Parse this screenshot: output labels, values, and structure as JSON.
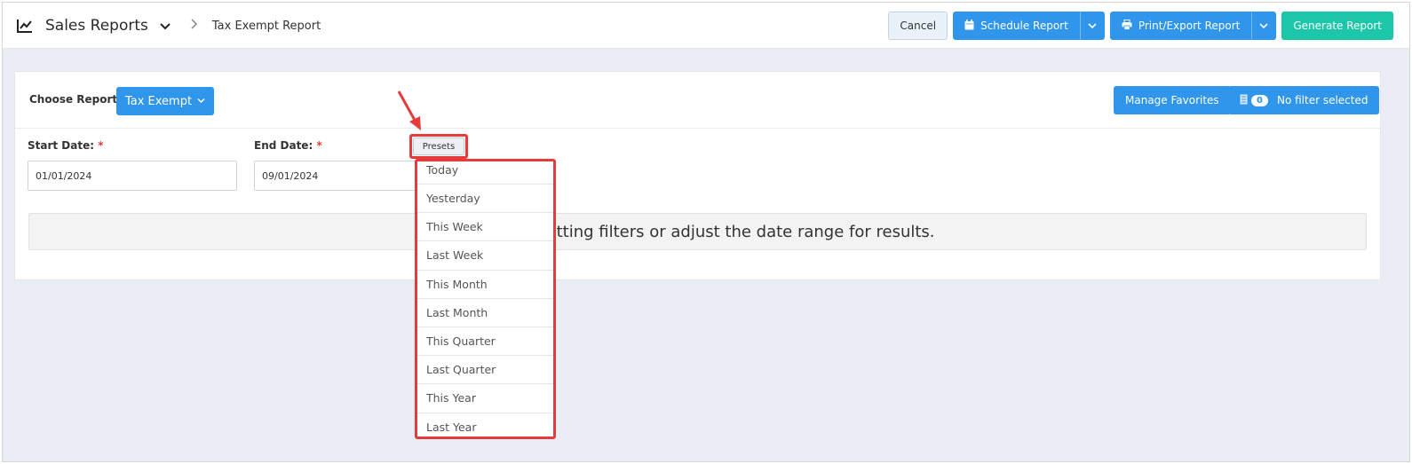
{
  "header": {
    "app_title": "Sales Reports",
    "breadcrumb_current": "Tax Exempt Report",
    "icons": {
      "chart": "line-chart-icon",
      "chevron": "chevron-down-icon",
      "separator": "chevron-right-icon"
    }
  },
  "top_actions": {
    "cancel_label": "Cancel",
    "schedule_label": "Schedule Report",
    "print_export_label": "Print/Export Report",
    "generate_label": "Generate Report"
  },
  "report_bar": {
    "choose_label": "Choose Report",
    "selected_report": "Tax Exempt",
    "manage_favorites_label": "Manage Favorites",
    "filter_count": "0",
    "filter_label": "No filter selected"
  },
  "dates": {
    "start_label": "Start Date:",
    "end_label": "End Date:",
    "required_mark": "*",
    "start_value": "01/01/2024",
    "end_value": "09/01/2024",
    "presets_label": "Presets"
  },
  "empty_message": "mpty. Try setting filters or adjust the date range for results.",
  "presets_menu": [
    "Today",
    "Yesterday",
    "This Week",
    "Last Week",
    "This Month",
    "Last Month",
    "This Quarter",
    "Last Quarter",
    "This Year",
    "Last Year"
  ],
  "colors": {
    "primary_blue": "#2f96ec",
    "teal": "#1bc6a9",
    "highlight_red": "#e53b3b",
    "background": "#ebedf5"
  }
}
